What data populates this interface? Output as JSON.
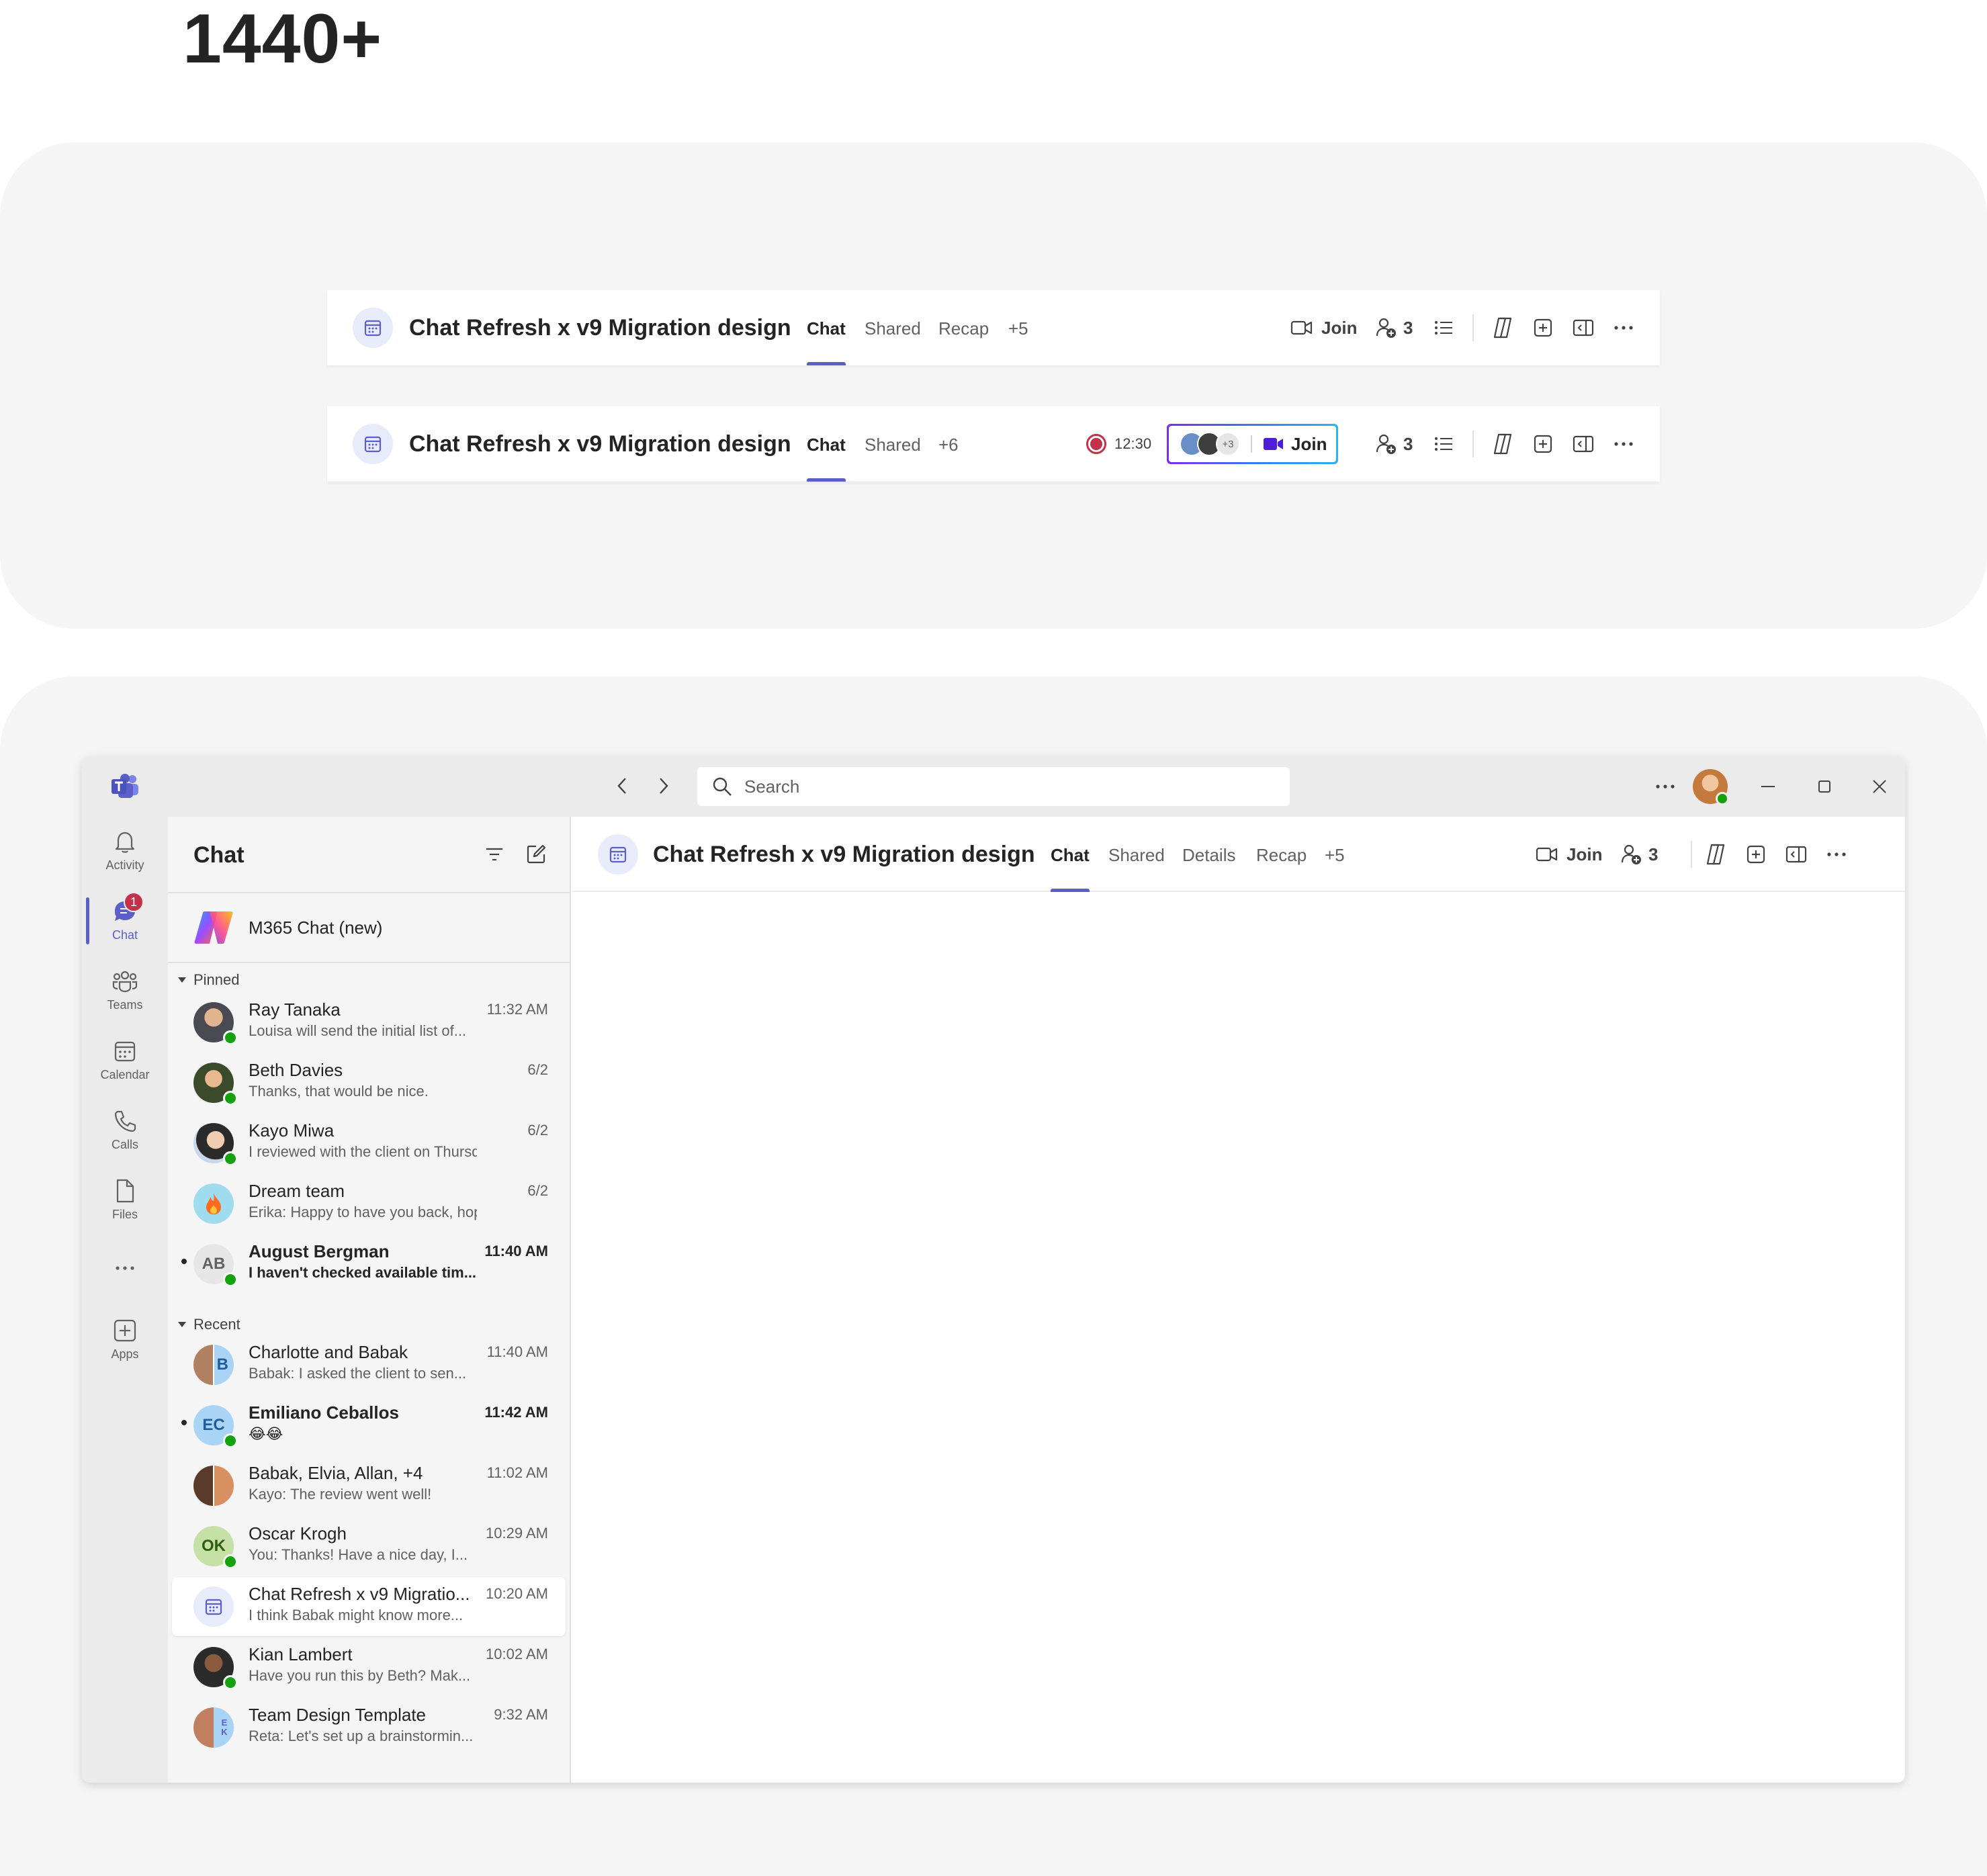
{
  "page": {
    "heading": "1440+"
  },
  "header_bar_1": {
    "title": "Chat Refresh x v9 Migration design",
    "tabs": [
      "Chat",
      "Shared",
      "Recap",
      "+5"
    ],
    "join_label": "Join",
    "participants_count": "3"
  },
  "header_bar_2": {
    "title": "Chat Refresh x v9 Migration design",
    "tabs": [
      "Chat",
      "Shared",
      "+6"
    ],
    "recording_time": "12:30",
    "extra_attendees": "+3",
    "join_label": "Join",
    "participants_count": "3"
  },
  "window": {
    "search": {
      "placeholder": "Search"
    },
    "rail": [
      {
        "label": "Activity",
        "icon": "bell-icon"
      },
      {
        "label": "Chat",
        "icon": "chat-icon",
        "badge": "1",
        "active": true
      },
      {
        "label": "Teams",
        "icon": "teams-icon"
      },
      {
        "label": "Calendar",
        "icon": "calendar-icon"
      },
      {
        "label": "Calls",
        "icon": "phone-icon"
      },
      {
        "label": "Files",
        "icon": "file-icon"
      },
      {
        "label": "Apps",
        "icon": "plus-square-icon"
      }
    ],
    "chat_list": {
      "title": "Chat",
      "m365_label": "M365 Chat (new)",
      "pinned_label": "Pinned",
      "recent_label": "Recent",
      "pinned": [
        {
          "name": "Ray Tanaka",
          "preview": "Louisa will send the initial list of...",
          "time": "11:32 AM"
        },
        {
          "name": "Beth Davies",
          "preview": "Thanks, that would be nice.",
          "time": "6/2"
        },
        {
          "name": "Kayo Miwa",
          "preview": "I reviewed with the client on Thursday",
          "time": "6/2"
        },
        {
          "name": "Dream team",
          "preview": "Erika: Happy to have you back, hope y...",
          "time": "6/2"
        },
        {
          "name": "August Bergman",
          "preview": "I haven't checked available tim...",
          "time": "11:40 AM",
          "initials": "AB",
          "unread": true
        }
      ],
      "recent": [
        {
          "name": "Charlotte and Babak",
          "preview": "Babak: I asked the client to sen...",
          "time": "11:40 AM",
          "initials": "B"
        },
        {
          "name": "Emiliano Ceballos",
          "preview": "😂😂",
          "time": "11:42 AM",
          "initials": "EC",
          "unread": true
        },
        {
          "name": "Babak, Elvia, Allan, +4",
          "preview": "Kayo: The review went well!",
          "time": "11:02 AM"
        },
        {
          "name": "Oscar Krogh",
          "preview": "You: Thanks! Have a nice day, I...",
          "time": "10:29 AM",
          "initials": "OK"
        },
        {
          "name": "Chat Refresh x v9 Migratio...",
          "preview": "I think Babak might know more...",
          "time": "10:20 AM",
          "selected": true
        },
        {
          "name": "Kian Lambert",
          "preview": "Have you run this by Beth? Mak...",
          "time": "10:02 AM"
        },
        {
          "name": "Team Design Template",
          "preview": "Reta: Let's set up a brainstormin...",
          "time": "9:32 AM",
          "initials": "E K"
        }
      ]
    },
    "header": {
      "title": "Chat Refresh x v9 Migration design",
      "tabs": [
        "Chat",
        "Shared",
        "Details",
        "Recap",
        "+5"
      ],
      "join_label": "Join",
      "participants_count": "3"
    }
  },
  "colors": {
    "accent": "#5b5fc7",
    "presence": "#13a10e",
    "badge": "#c4314b",
    "recording": "#c4314b"
  }
}
